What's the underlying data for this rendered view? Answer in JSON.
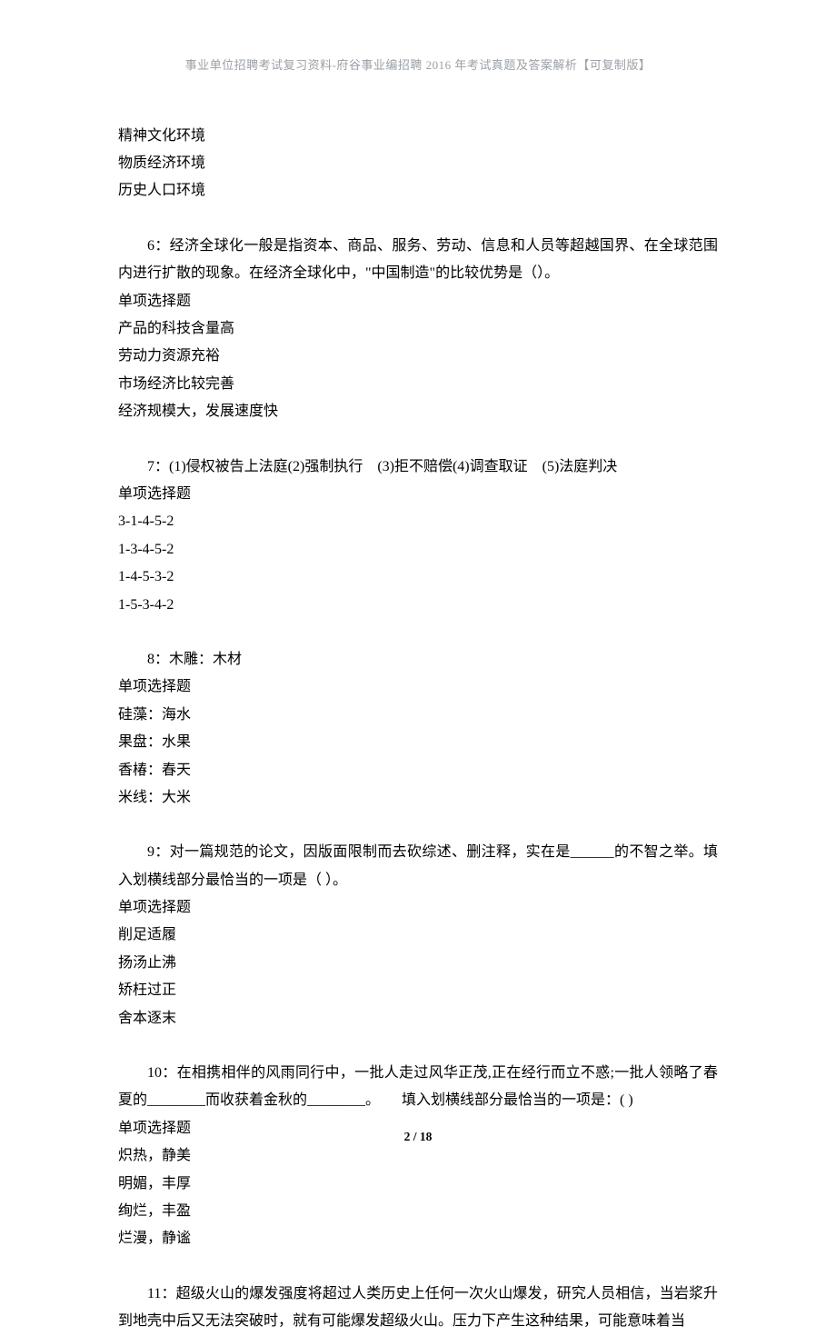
{
  "header": "事业单位招聘考试复习资料-府谷事业编招聘 2016 年考试真题及答案解析【可复制版】",
  "top_lines": [
    "精神文化环境",
    "物质经济环境",
    "历史人口环境"
  ],
  "q6": {
    "stem": "6：经济全球化一般是指资本、商品、服务、劳动、信息和人员等超越国界、在全球范围内进行扩散的现象。在经济全球化中，\"中国制造\"的比较优势是（）。",
    "type": "单项选择题",
    "options": [
      "产品的科技含量高",
      "劳动力资源充裕",
      "市场经济比较完善",
      "经济规模大，发展速度快"
    ]
  },
  "q7": {
    "stem": "7：(1)侵权被告上法庭(2)强制执行　(3)拒不赔偿(4)调查取证　(5)法庭判决",
    "type": "单项选择题",
    "options": [
      "3-1-4-5-2",
      "1-3-4-5-2",
      "1-4-5-3-2",
      "1-5-3-4-2"
    ]
  },
  "q8": {
    "stem": "8：木雕：木材",
    "type": "单项选择题",
    "options": [
      "硅藻：海水",
      "果盘：水果",
      "香椿：春天",
      "米线：大米"
    ]
  },
  "q9": {
    "stem": "9：对一篇规范的论文，因版面限制而去砍综述、删注释，实在是______的不智之举。填入划横线部分最恰当的一项是（ ）。",
    "type": "单项选择题",
    "options": [
      "削足适履",
      "扬汤止沸",
      "矫枉过正",
      "舍本逐末"
    ]
  },
  "q10": {
    "stem": "10：在相携相伴的风雨同行中，一批人走过风华正茂,正在经行而立不惑;一批人领略了春夏的________而收获着金秋的________。　　填入划横线部分最恰当的一项是：(  )",
    "type": "单项选择题",
    "options": [
      "炽热，静美",
      "明媚，丰厚",
      "绚烂，丰盈",
      "烂漫，静谧"
    ]
  },
  "q11": {
    "stem": "11：超级火山的爆发强度将超过人类历史上任何一次火山爆发，研究人员相信，当岩浆升到地壳中后又无法突破时，就有可能爆发超级火山。压力下产生这种结果，可能意味着当"
  },
  "footer": "2 / 18"
}
